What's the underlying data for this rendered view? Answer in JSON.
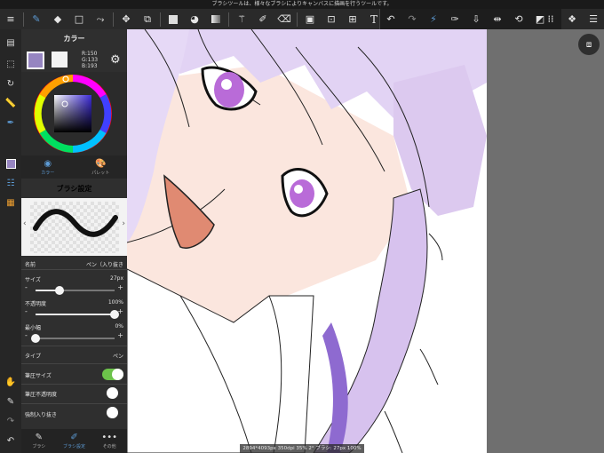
{
  "top_hint": "ブラシツールは、様々なブラシによりキャンバスに描画を行うツールです。",
  "toolbar": {
    "left_icons": [
      "menu-icon",
      "brush-tool-icon",
      "eraser-tool-icon",
      "select-rect-icon",
      "lasso-icon",
      "move-icon",
      "transform-icon",
      "fill-color-icon",
      "bucket-icon",
      "gradient-icon",
      "magic-wand-icon",
      "select-pen-icon",
      "select-eraser-icon",
      "select-all-icon",
      "select-clear-icon",
      "select-transform-icon",
      "text-icon"
    ],
    "text_tool_glyph": "T",
    "group2_icons": [
      "undo-icon",
      "redo-icon",
      "brush-snap-icon",
      "eyedropper-icon",
      "save-icon",
      "flip-icon",
      "hand-rotate-icon",
      "layer-clear-icon"
    ],
    "right_icons": [
      "grid-icon",
      "material-icon",
      "layers-icon"
    ]
  },
  "color_panel": {
    "title": "カラー",
    "main_color": "#9685c1",
    "sub_color": "#f4f4f4",
    "r": "R:150",
    "g": "G:133",
    "b": "B:193",
    "tab_color": "カラー",
    "tab_palette": "パレット"
  },
  "brush_panel": {
    "title": "ブラシ設定",
    "name_label": "名前",
    "name_value": "ペン（入り抜き",
    "size_label": "サイズ",
    "size_value": "27px",
    "size_level": 0.3,
    "opacity_label": "不透明度",
    "opacity_value": "100%",
    "opacity_level": 1.0,
    "min_width_label": "最小幅",
    "min_width_value": "0%",
    "min_width_level": 0.0,
    "type_label": "タイプ",
    "type_value": "ペン",
    "pressure_size_label": "筆圧サイズ",
    "pressure_size_on": true,
    "pressure_opacity_label": "筆圧不透明度",
    "pressure_opacity_on": false,
    "force_fade_label": "強制入り抜き",
    "force_fade_on": false
  },
  "bottom_tabs": {
    "brush": "ブラシ",
    "brush_settings": "ブラシ設定",
    "more": "その他",
    "more_glyph": "•••"
  },
  "status": "2894*4093px 350dpi 35% 2° ブラシ: 27px 100%",
  "colors": {
    "accent": "#5d9bd5",
    "toggle_on": "#6cc24a",
    "hair": "#d9c6f0",
    "skin": "#fbe6de",
    "eye": "#b96bd8",
    "mouth": "#e08a72"
  }
}
